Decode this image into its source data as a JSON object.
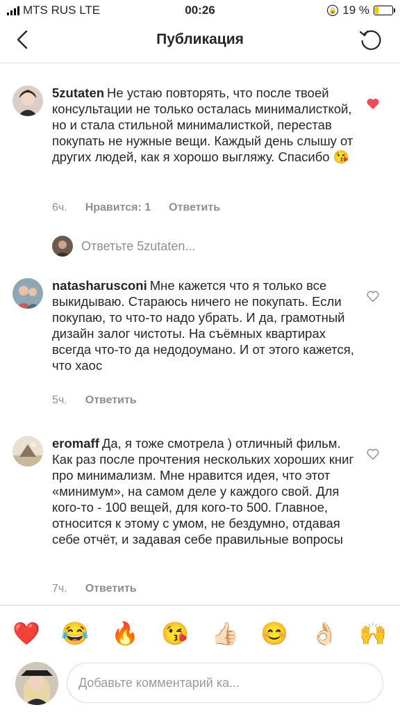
{
  "status_bar": {
    "carrier": "MTS RUS LTE",
    "time": "00:26",
    "battery_percent": "19 %",
    "battery_level": 0.19
  },
  "header": {
    "title": "Публикация"
  },
  "comments": [
    {
      "username": "5zutaten",
      "text": "Не устаю повторять, что после твоей консультации не только осталась минималисткой, но и стала стильной минималисткой, перестав покупать не нужные вещи. Каждый день слышу от других людей, как я хорошо выгляжу. Спасибо 😘",
      "time": "6ч.",
      "likes": "Нравится: 1",
      "reply": "Ответить",
      "liked": true
    },
    {
      "username": "natasharusconi",
      "text": "Мне кажется что я только все выкидываю. Стараюсь ничего не покупать. Если покупаю, то что-то надо убрать. И да, грамотный дизайн залог чистоты. На съёмных квартирах всегда что-то да недодоумано. И от этого кажется, что хаос",
      "time": "5ч.",
      "reply": "Ответить",
      "liked": false
    },
    {
      "username": "eromaff",
      "text": "Да, я тоже смотрела ) отличный фильм. Как раз после прочтения нескольких хороших книг про минимализм. Мне нравится идея, что этот «минимум», на самом деле у каждого свой. Для кого-то - 100 вещей, для кого-то 500. Главное, относится к этому с умом, не бездумно, отдавая себе отчёт, и задавая себе правильные вопросы",
      "time": "7ч.",
      "reply": "Ответить",
      "liked": false
    }
  ],
  "reply_prompt": "Ответьте 5zutaten...",
  "emoji_bar": [
    "❤️",
    "😂",
    "🔥",
    "😘",
    "👍🏻",
    "😊",
    "👌🏻",
    "🙌"
  ],
  "composer": {
    "placeholder": "Добавьте комментарий ка..."
  },
  "colors": {
    "liked_heart": "#ed4956",
    "muted_text": "#8e8e8e",
    "divider": "#dbdbdb"
  }
}
